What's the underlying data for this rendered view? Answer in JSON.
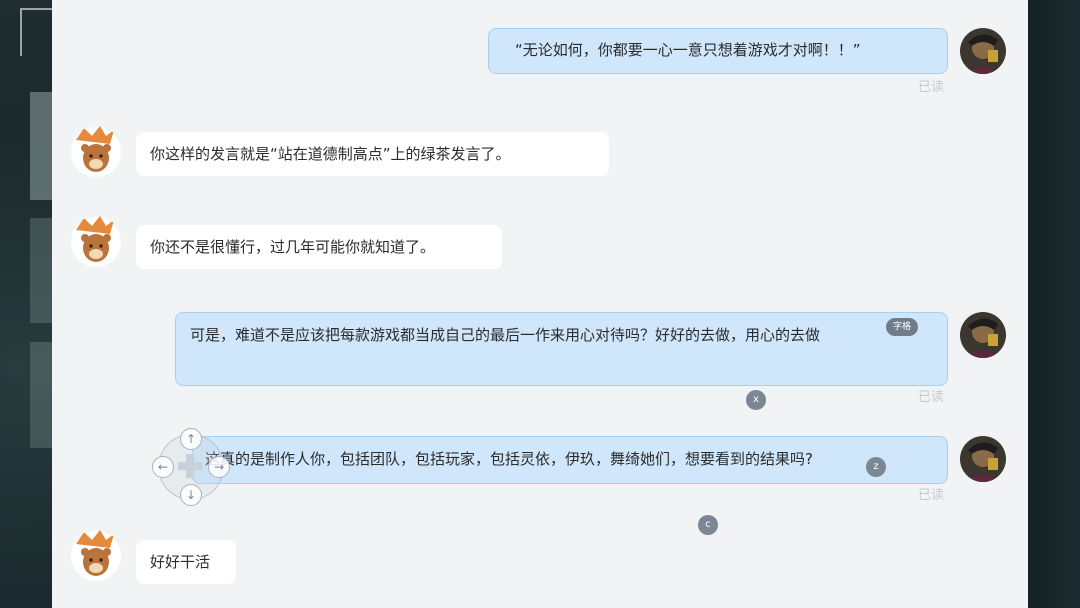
{
  "messages": [
    {
      "id": "m1",
      "side": "out",
      "text": "“无论如何，你都要一心一意只想着游戏才对啊！！”",
      "read": "已读"
    },
    {
      "id": "m2",
      "side": "in",
      "text": "你这样的发言就是“站在道德制高点”上的绿茶发言了。"
    },
    {
      "id": "m3",
      "side": "in",
      "text": "你还不是很懂行，过几年可能你就知道了。"
    },
    {
      "id": "m4",
      "side": "out",
      "text": "可是，难道不是应该把每款游戏都当成自己的最后一作来用心对待吗？好好的去做，用心的去做",
      "read": "已读"
    },
    {
      "id": "m5",
      "side": "out",
      "text": "这真的是制作人你，包括团队，包括玩家，包括灵依，伊玖，舞绮她们，想要看到的结果吗?",
      "read": "已读"
    },
    {
      "id": "m6",
      "side": "in",
      "text": "好好干活"
    }
  ],
  "overlay": {
    "tooltip": "字格",
    "key_x": "x",
    "key_z": "z",
    "key_c": "c",
    "dpad": {
      "up": "↑",
      "down": "↓",
      "left": "←",
      "right": "→"
    }
  },
  "colors": {
    "out_bubble": "#cfe6fb",
    "in_bubble": "#ffffff",
    "panel": "#f2f3f4"
  }
}
